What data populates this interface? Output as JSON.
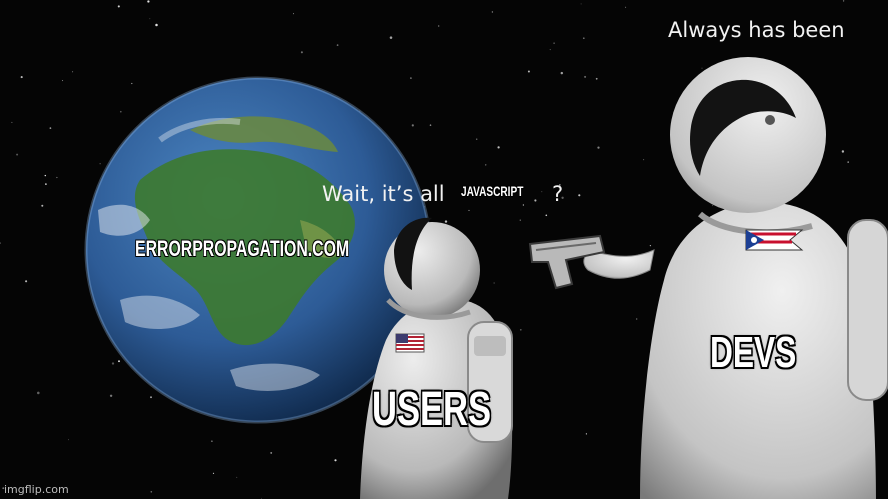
{
  "meme": {
    "caption_top_right": "Always has been",
    "caption_middle_left": "Wait, it’s all",
    "caption_middle_right": "?",
    "label_inserted": "JAVASCRIPT",
    "label_earth": "ERRORPROPAGATION.COM",
    "label_left_astronaut": "USERS",
    "label_right_astronaut": "DEVS",
    "watermark": "imgflip.com"
  },
  "colors": {
    "space": "#050505",
    "earth_ocean": "#2f5f9e",
    "earth_land": "#3d7a2f",
    "suit": "#cfcfcf",
    "visor": "#111111",
    "text": "#ffffff"
  },
  "icons": [
    "earth-icon",
    "stars-background",
    "astronaut-icon",
    "pistol-icon",
    "us-flag-icon",
    "ohio-flag-icon"
  ]
}
